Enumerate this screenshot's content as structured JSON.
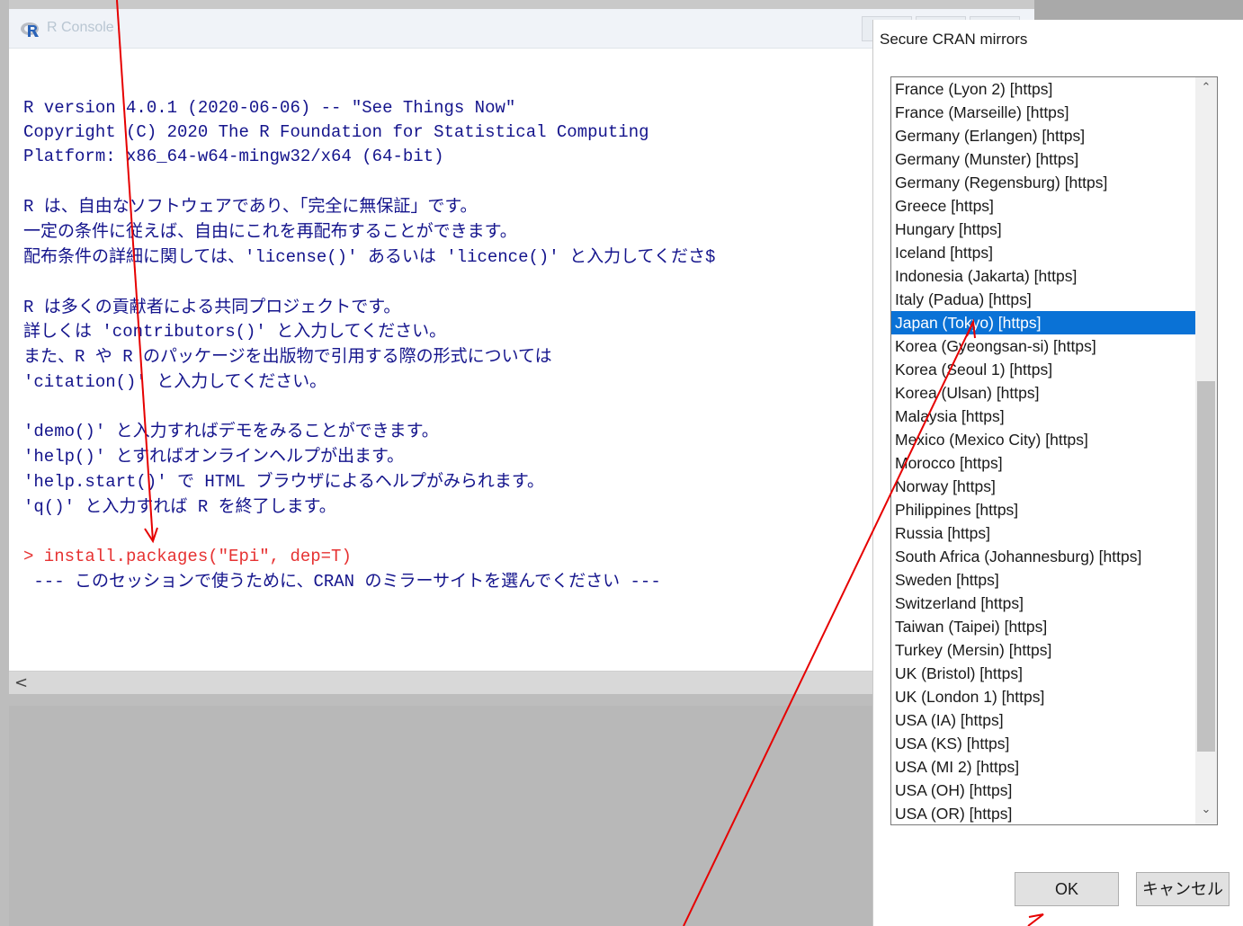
{
  "console": {
    "title": "R Console",
    "lines": [
      "R version 4.0.1 (2020-06-06) -- \"See Things Now\"",
      "Copyright (C) 2020 The R Foundation for Statistical Computing",
      "Platform: x86_64-w64-mingw32/x64 (64-bit)",
      "R は、自由なソフトウェアであり、「完全に無保証」です。",
      "一定の条件に従えば、自由にこれを再配布することができます。",
      "配布条件の詳細に関しては、'license()' あるいは 'licence()' と入力してくださ$",
      "R は多くの貢献者による共同プロジェクトです。",
      "詳しくは 'contributors()' と入力してください。",
      "また、R や R のパッケージを出版物で引用する際の形式については",
      "'citation()' と入力してください。",
      "'demo()' と入力すればデモをみることができます。",
      "'help()' とすればオンラインヘルプが出ます。",
      "'help.start()' で HTML ブラウザによるヘルプがみられます。",
      "'q()' と入力すれば R を終了します。",
      "> install.packages(\"Epi\", dep=T)",
      " --- このセッションで使うために、CRAN のミラーサイトを選んでください ---"
    ],
    "scroll_left_icon": "<"
  },
  "dialog": {
    "title": "Secure CRAN mirrors",
    "mirrors": [
      "France (Lyon 2) [https]",
      "France (Marseille) [https]",
      "Germany (Erlangen) [https]",
      "Germany (Munster) [https]",
      "Germany (Regensburg) [https]",
      "Greece [https]",
      "Hungary [https]",
      "Iceland [https]",
      "Indonesia (Jakarta) [https]",
      "Italy (Padua) [https]",
      "Japan (Tokyo) [https]",
      "Korea (Gyeongsan-si) [https]",
      "Korea (Seoul 1) [https]",
      "Korea (Ulsan) [https]",
      "Malaysia [https]",
      "Mexico (Mexico City) [https]",
      "Morocco [https]",
      "Norway [https]",
      "Philippines [https]",
      "Russia [https]",
      "South Africa (Johannesburg) [https]",
      "Sweden [https]",
      "Switzerland [https]",
      "Taiwan (Taipei) [https]",
      "Turkey (Mersin) [https]",
      "UK (Bristol) [https]",
      "UK (London 1) [https]",
      "USA (IA) [https]",
      "USA (KS) [https]",
      "USA (MI 2) [https]",
      "USA (OH) [https]",
      "USA (OR) [https]"
    ],
    "selected_mirror": "Japan (Tokyo) [https]",
    "ok_label": "OK",
    "cancel_label": "キャンセル"
  },
  "colors": {
    "console_text": "#14148c",
    "prompt_text": "#e63232",
    "selection": "#0a72d6",
    "annotation_arrow": "#e60000"
  },
  "icons": {
    "r_logo": "r-logo-icon",
    "scroll_up": "chevron-up-icon",
    "scroll_down": "chevron-down-icon",
    "scroll_left": "chevron-left-icon"
  }
}
